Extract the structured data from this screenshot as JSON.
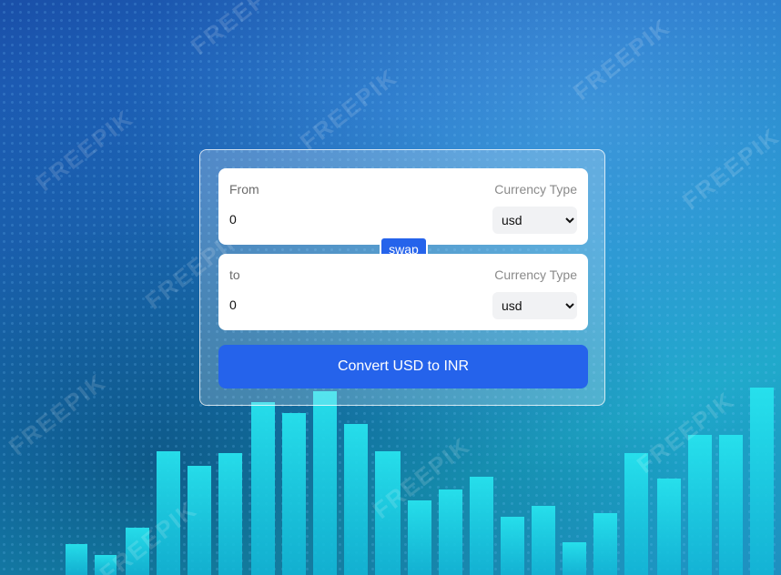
{
  "background": {
    "watermark_text": "FREEPIK",
    "colors": {
      "deep_blue": "#1a4fa8",
      "cyan_bars": "#1ad9e6"
    }
  },
  "converter": {
    "from": {
      "label": "From",
      "currency_type_label": "Currency Type",
      "amount_value": "0",
      "selected_currency": "usd",
      "options": [
        "usd"
      ]
    },
    "to": {
      "label": "to",
      "currency_type_label": "Currency Type",
      "amount_value": "0",
      "selected_currency": "usd",
      "options": [
        "usd"
      ]
    },
    "swap_label": "swap",
    "convert_label": "Convert USD to INR"
  },
  "colors": {
    "accent": "#2563eb",
    "field_bg": "#ffffff",
    "select_bg": "#f1f2f4"
  }
}
